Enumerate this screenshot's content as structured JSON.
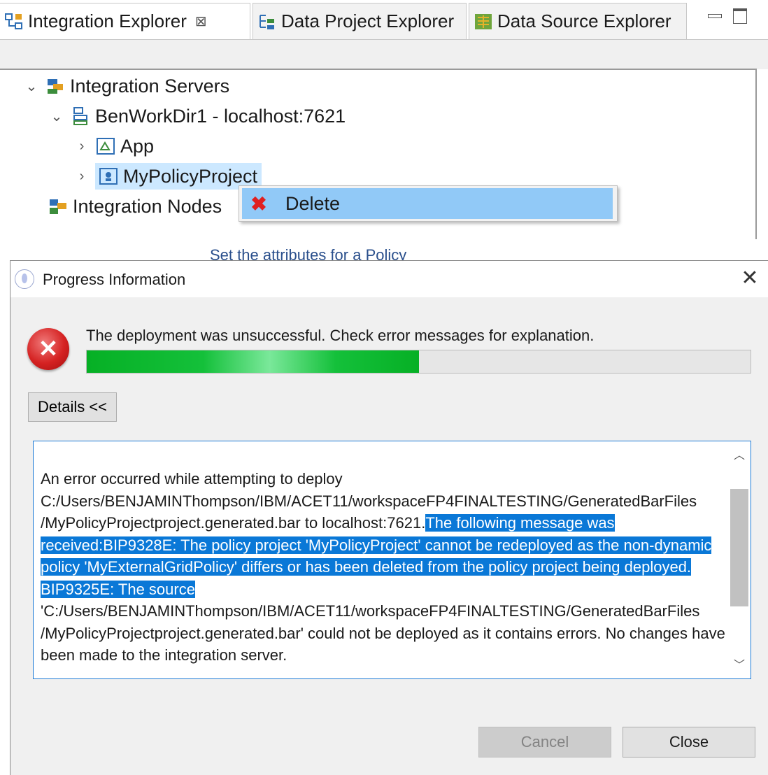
{
  "tabs": [
    {
      "label": "Integration Explorer",
      "close": "⊠",
      "icon": "integration-explorer-icon"
    },
    {
      "label": "Data Project Explorer",
      "icon": "data-project-explorer-icon"
    },
    {
      "label": "Data Source Explorer",
      "icon": "data-source-explorer-icon"
    }
  ],
  "tree": {
    "integration_servers": "Integration Servers",
    "server": "BenWorkDir1 - localhost:7621",
    "app": "App",
    "policy_project": "MyPolicyProject",
    "integration_nodes": "Integration Nodes"
  },
  "context_menu": {
    "delete_label": "Delete",
    "delete_color": "#e02020"
  },
  "background_text": "Set the attributes for a Policy",
  "dialog": {
    "title": "Progress Information",
    "close_glyph": "✕",
    "status_message": "The deployment was unsuccessful. Check error messages for explanation.",
    "progress_fraction": 0.5,
    "details_button": "Details <<",
    "details": {
      "pre": "An error occurred while attempting to deploy C:/Users/BENJAMINThompson/IBM/ACET11/workspaceFP4FINALTESTING/GeneratedBarFiles /MyPolicyProjectproject.generated.bar to localhost:7621.",
      "highlighted": "The following message was received:BIP9328E: The policy project 'MyPolicyProject' cannot be redeployed as the non-dynamic policy 'MyExternalGridPolicy' differs or has been deleted from the policy project being deployed. BIP9325E: The source",
      "post": " 'C:/Users/BENJAMINThompson/IBM/ACET11/workspaceFP4FINALTESTING/GeneratedBarFiles /MyPolicyProjectproject.generated.bar' could not be deployed as it contains errors. No changes have been made to the integration server."
    },
    "cancel_label": "Cancel",
    "close_label": "Close"
  },
  "colors": {
    "selection": "#cce8ff",
    "menu_highlight": "#91c9f7",
    "text_highlight": "#0a78d7",
    "progress_green": "#06b025",
    "error_red": "#d52222"
  }
}
